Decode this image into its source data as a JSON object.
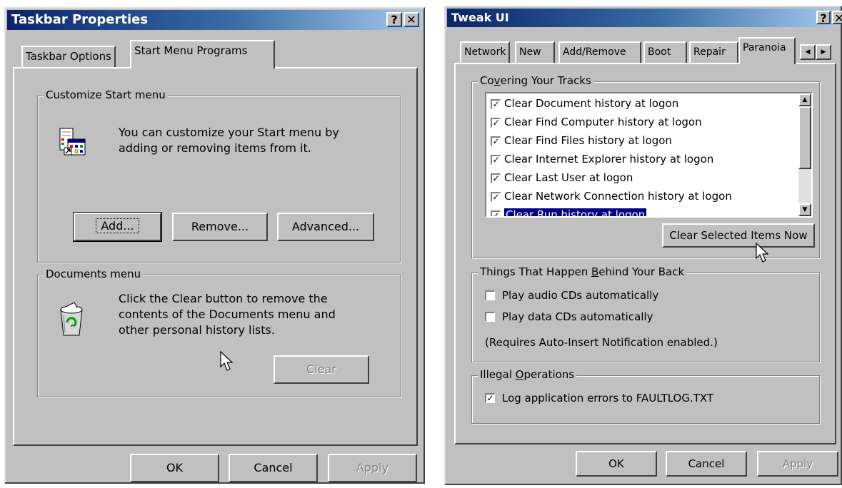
{
  "left_window": {
    "title": "Taskbar Properties",
    "help_btn": "?",
    "close_btn": "✕",
    "tabs": [
      "Taskbar Options",
      "Start Menu Programs"
    ],
    "customize_group": {
      "legend": "Customize Start menu",
      "text": "You can customize your Start menu by adding or removing items from it.",
      "add": "Add...",
      "remove": "Remove...",
      "advanced": "Advanced..."
    },
    "documents_group": {
      "legend": "Documents menu",
      "text": "Click the Clear button to remove the contents of the Documents menu and other personal history lists.",
      "clear": "Clear"
    },
    "ok": "OK",
    "cancel": "Cancel",
    "apply": "Apply"
  },
  "right_window": {
    "title": "Tweak UI",
    "help_btn": "?",
    "close_btn": "✕",
    "tabs": [
      "Network",
      "New",
      "Add/Remove",
      "Boot",
      "Repair",
      "Paranoia"
    ],
    "tracks_group": {
      "legend": "Covering Your Tracks",
      "items": [
        "Clear Document history at logon",
        "Clear Find Computer history at logon",
        "Clear Find Files history at logon",
        "Clear Internet Explorer history at logon",
        "Clear Last User at logon",
        "Clear Network Connection history at logon",
        "Clear Run history at logon"
      ],
      "clear_now": "Clear Selected Items Now"
    },
    "behind_group": {
      "legend": "Things That Happen Behind Your Back",
      "audio": "Play audio CDs automatically",
      "data": "Play data CDs automatically",
      "note": "(Requires Auto-Insert Notification enabled.)"
    },
    "illegal_group": {
      "legend": "Illegal Operations",
      "log": "Log application errors to FAULTLOG.TXT"
    },
    "ok": "OK",
    "cancel": "Cancel",
    "apply": "Apply"
  }
}
